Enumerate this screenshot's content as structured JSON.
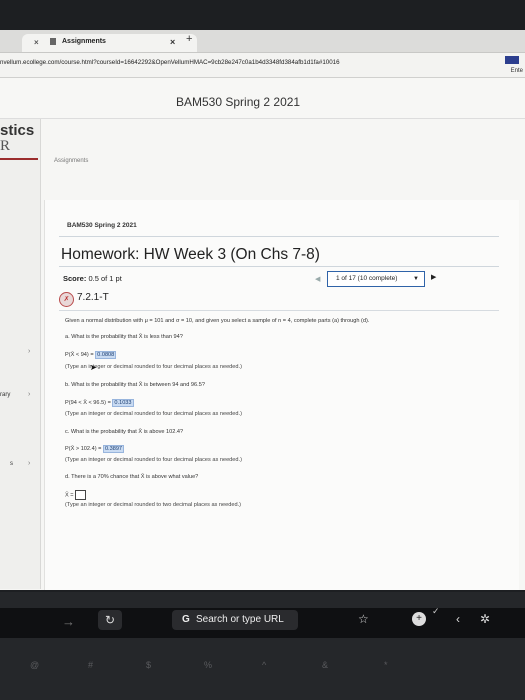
{
  "browser": {
    "tab_title": "Assignments",
    "tab_close": "×",
    "tab_close2": "×",
    "new_tab": "+",
    "url": "nvellum.ecollege.com/course.html?courseId=16642292&OpenVellumHMAC=9cb28e247c0a1b4d3348fd384afb1d1fa#10016",
    "ext_label": "Ente"
  },
  "course": {
    "title": "BAM530 Spring 2 2021",
    "left_title": "stics",
    "left_logo": "R",
    "left_link_1": "rary",
    "left_link_2": "s",
    "assignments_link": "Assignments"
  },
  "panel": {
    "breadcrumb": "BAM530 Spring 2 2021",
    "hw_title": "Homework: HW Week 3 (On Chs 7-8)",
    "score_label": "Score:",
    "score_value": "0.5 of 1 pt",
    "nav_status": "1 of 17 (10 complete)",
    "question_number": "7.2.1-T",
    "intro": "Given a normal distribution with μ = 101 and σ = 10, and given you select a sample of n = 4, complete parts (a) through (d).",
    "parts": [
      {
        "question": "a. What is the probability that X̄ is less than 94?",
        "answer_prefix": "P(X̄ < 94) = ",
        "answer": "0.0808",
        "hint": "(Type an integer or decimal rounded to four decimal places as needed.)"
      },
      {
        "question": "b. What is the probability that X̄ is between 94 and 96.5?",
        "answer_prefix": "P(94 < X̄ < 96.5) = ",
        "answer": "0.1033",
        "hint": "(Type an integer or decimal rounded to four decimal places as needed.)"
      },
      {
        "question": "c. What is the probability that X̄ is above 102.4?",
        "answer_prefix": "P(X̄ > 102.4) = ",
        "answer": "0.3897",
        "hint": "(Type an integer or decimal rounded to four decimal places as needed.)"
      },
      {
        "question": "d. There is a 70% chance that X̄ is above what value?",
        "answer_prefix": "X̄ = ",
        "answer": "",
        "hint": "(Type an integer or decimal rounded to two decimal places as needed.)"
      }
    ]
  },
  "touchbar": {
    "search_label": "Search or type URL",
    "search_g": "G"
  },
  "keys": [
    "@",
    "#",
    "$",
    "%",
    "^",
    "&",
    "*"
  ]
}
